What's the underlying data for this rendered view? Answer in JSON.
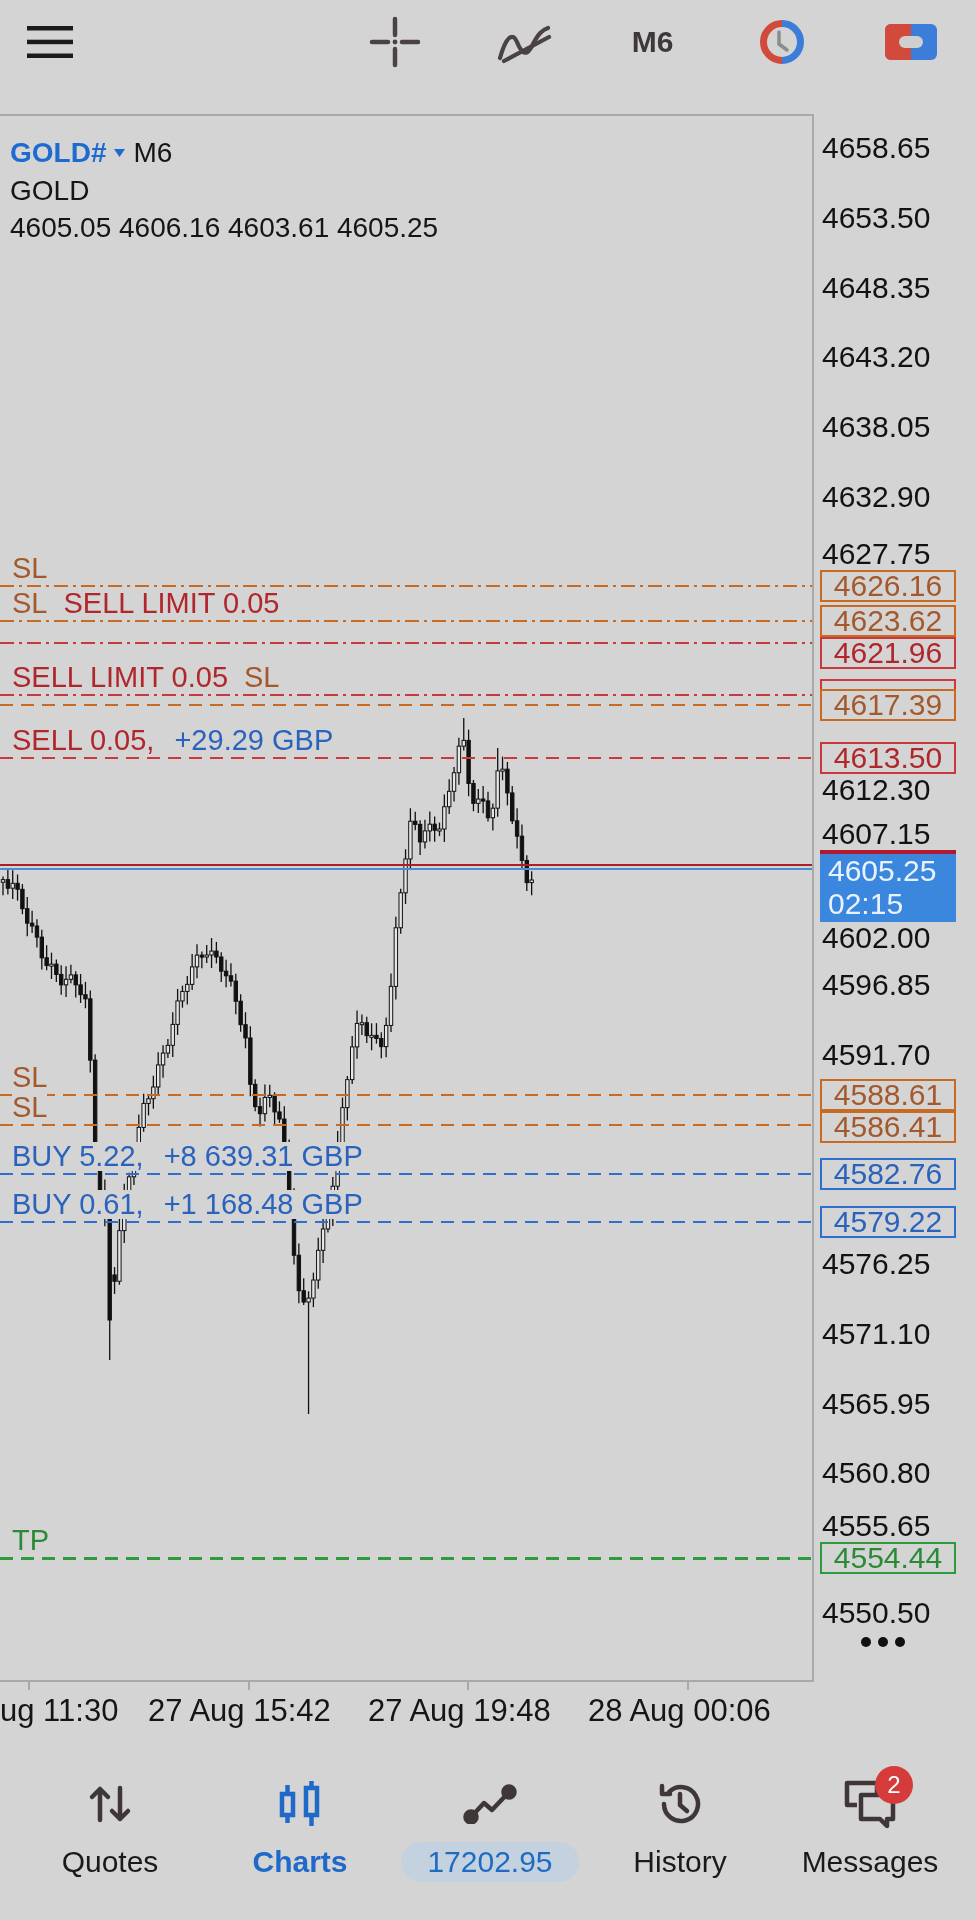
{
  "toolbar": {
    "timeframe": "M6"
  },
  "chart": {
    "symbol": "GOLD#",
    "timeframe": "M6",
    "description": "GOLD",
    "ohlc": "4605.05 4606.16 4603.61 4605.25",
    "price_axis": [
      "4658.65",
      "4653.50",
      "4648.35",
      "4643.20",
      "4638.05",
      "4632.90",
      "4627.75",
      "4612.30",
      "4607.15",
      "4602.00",
      "4596.85",
      "4591.70",
      "4576.25",
      "4571.10",
      "4565.95",
      "4560.80",
      "4555.65",
      "4550.50"
    ],
    "current_price": {
      "bid": "4605.25",
      "timer": "02:15"
    },
    "order_lines": [
      {
        "kind": "sl",
        "label": "SL",
        "tag": "4626.16",
        "pending": true
      },
      {
        "kind": "sl",
        "label": "SL",
        "tag": "4623.62",
        "pending": true
      },
      {
        "kind": "sell_limit",
        "label": "SELL LIMIT 0.05",
        "tag": "4621.96",
        "pending": true
      },
      {
        "kind": "sell_limit",
        "label": "SELL LIMIT 0.05",
        "pending": true
      },
      {
        "kind": "sl",
        "label": "SL",
        "tag": "4617.39",
        "pending": false
      },
      {
        "kind": "sell",
        "label": "SELL 0.05,",
        "profit": "+29.29 GBP",
        "tag": "4613.50",
        "pending": false
      },
      {
        "kind": "sl",
        "label": "SL",
        "tag": "4588.61",
        "pending": false
      },
      {
        "kind": "sl",
        "label": "SL",
        "tag": "4586.41",
        "pending": false
      },
      {
        "kind": "buy",
        "label": "BUY 5.22,",
        "profit": "+8 639.31 GBP",
        "tag": "4582.76",
        "pending": false
      },
      {
        "kind": "buy",
        "label": "BUY 0.61,",
        "profit": "+1 168.48 GBP",
        "tag": "4579.22",
        "pending": false
      },
      {
        "kind": "tp",
        "label": "TP",
        "tag": "4554.44",
        "pending": false
      }
    ],
    "time_axis": [
      "ug 11:30",
      "27 Aug 15:42",
      "27 Aug 19:48",
      "28 Aug 00:06"
    ]
  },
  "bottom_nav": [
    {
      "kind": "tab",
      "label": "Quotes",
      "selected": false
    },
    {
      "kind": "tab",
      "label": "Charts",
      "selected": true
    },
    {
      "kind": "balance",
      "label": "17202.95",
      "selected": false
    },
    {
      "kind": "tab",
      "label": "History",
      "selected": false
    },
    {
      "kind": "tab",
      "label": "Messages",
      "selected": false,
      "badge": "2"
    }
  ]
}
